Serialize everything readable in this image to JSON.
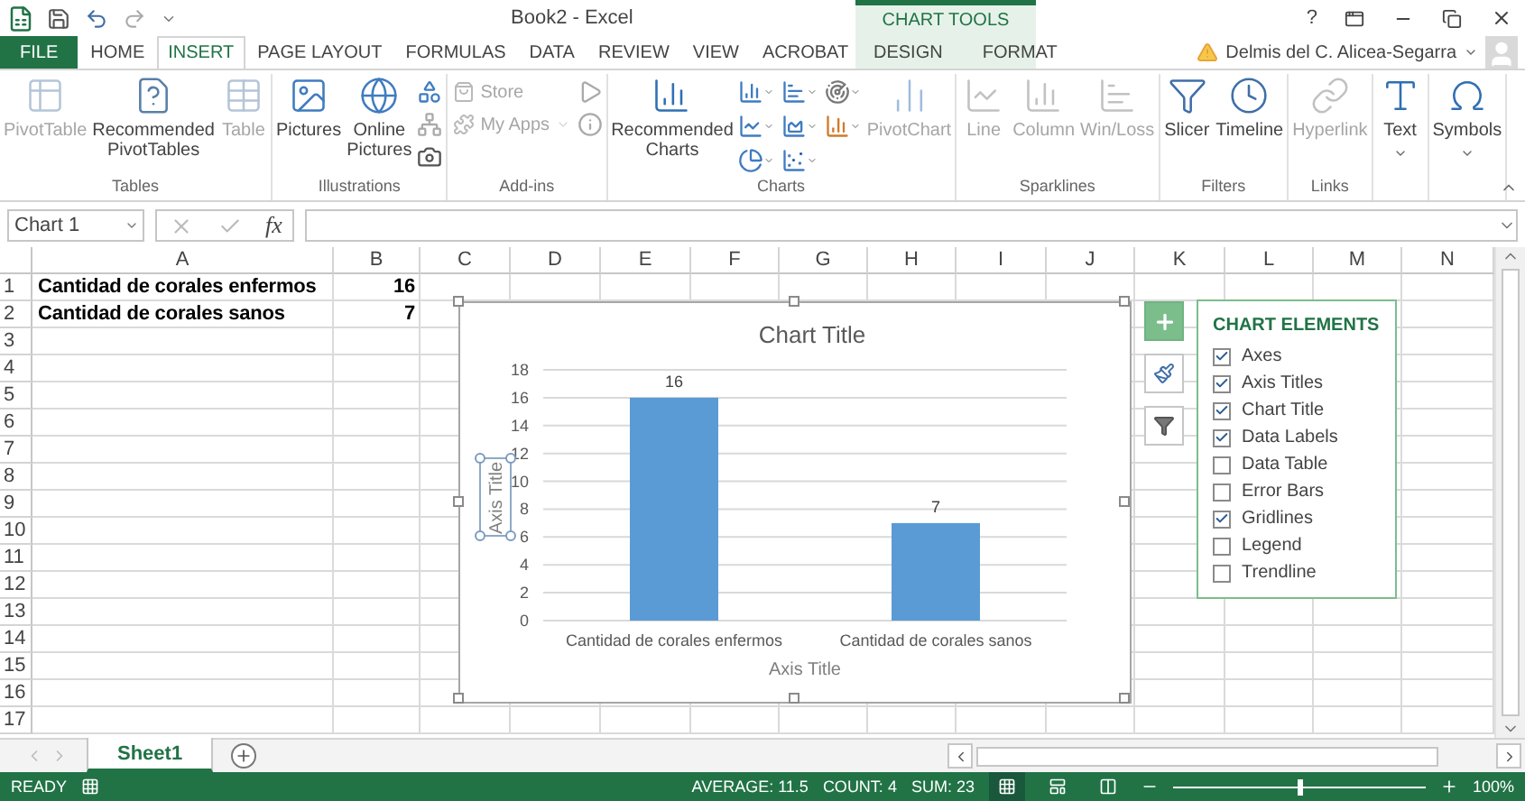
{
  "title_bar": {
    "title": "Book2 - Excel",
    "context_label": "CHART TOOLS",
    "help": "?"
  },
  "tabs": [
    {
      "label": "FILE",
      "kind": "file",
      "selected": false
    },
    {
      "label": "HOME",
      "kind": "normal",
      "selected": false
    },
    {
      "label": "INSERT",
      "kind": "normal",
      "selected": true
    },
    {
      "label": "PAGE LAYOUT",
      "kind": "normal",
      "selected": false
    },
    {
      "label": "FORMULAS",
      "kind": "normal",
      "selected": false
    },
    {
      "label": "DATA",
      "kind": "normal",
      "selected": false
    },
    {
      "label": "REVIEW",
      "kind": "normal",
      "selected": false
    },
    {
      "label": "VIEW",
      "kind": "normal",
      "selected": false
    },
    {
      "label": "ACROBAT",
      "kind": "normal",
      "selected": false
    },
    {
      "label": "DESIGN",
      "kind": "context",
      "selected": false
    },
    {
      "label": "FORMAT",
      "kind": "context",
      "selected": false
    }
  ],
  "user": {
    "name": "Delmis del C. Alicea-Segarra"
  },
  "ribbon": {
    "groups": [
      {
        "label": "Tables",
        "items": [
          {
            "label": "PivotTable",
            "kind": "large",
            "disabled": true
          },
          {
            "label": "Recommended PivotTables",
            "kind": "large",
            "disabled": false
          },
          {
            "label": "Table",
            "kind": "large",
            "disabled": true
          }
        ]
      },
      {
        "label": "Illustrations",
        "items": [
          {
            "label": "Pictures",
            "kind": "large",
            "disabled": false
          },
          {
            "label": "Online Pictures",
            "kind": "large",
            "disabled": false
          }
        ]
      },
      {
        "label": "Add-ins",
        "items": [
          {
            "label": "Store",
            "kind": "small",
            "disabled": true
          },
          {
            "label": "My Apps",
            "kind": "small",
            "disabled": true
          }
        ]
      },
      {
        "label": "Charts",
        "items": [
          {
            "label": "Recommended Charts",
            "kind": "large",
            "disabled": false
          },
          {
            "label": "PivotChart",
            "kind": "large",
            "disabled": true
          }
        ]
      },
      {
        "label": "Sparklines",
        "items": [
          {
            "label": "Line",
            "kind": "large",
            "disabled": true
          },
          {
            "label": "Column",
            "kind": "large",
            "disabled": true
          },
          {
            "label": "Win/Loss",
            "kind": "large",
            "disabled": true
          }
        ]
      },
      {
        "label": "Filters",
        "items": [
          {
            "label": "Slicer",
            "kind": "large",
            "disabled": false
          },
          {
            "label": "Timeline",
            "kind": "large",
            "disabled": false
          }
        ]
      },
      {
        "label": "Links",
        "items": [
          {
            "label": "Hyperlink",
            "kind": "large",
            "disabled": true
          }
        ]
      },
      {
        "items": [
          {
            "label": "Text",
            "kind": "large",
            "disabled": false
          }
        ]
      },
      {
        "items": [
          {
            "label": "Symbols",
            "kind": "large",
            "disabled": false
          }
        ]
      }
    ]
  },
  "formula_bar": {
    "name_box": "Chart 1",
    "function_label": "fx"
  },
  "columns": [
    "A",
    "B",
    "C",
    "D",
    "E",
    "F",
    "G",
    "H",
    "I",
    "J",
    "K",
    "L",
    "M",
    "N"
  ],
  "rows": [
    {
      "number": "1",
      "cells": [
        {
          "text": "Cantidad de corales enfermos",
          "kind": "text"
        },
        {
          "text": "16",
          "kind": "number"
        }
      ]
    },
    {
      "number": "2",
      "cells": [
        {
          "text": "Cantidad de corales sanos",
          "kind": "text"
        },
        {
          "text": "7",
          "kind": "number"
        }
      ]
    },
    {
      "number": "3"
    },
    {
      "number": "4"
    },
    {
      "number": "5"
    },
    {
      "number": "6"
    },
    {
      "number": "7"
    },
    {
      "number": "8"
    },
    {
      "number": "9"
    },
    {
      "number": "10"
    },
    {
      "number": "11"
    },
    {
      "number": "12"
    },
    {
      "number": "13"
    },
    {
      "number": "14"
    },
    {
      "number": "15"
    },
    {
      "number": "16"
    },
    {
      "number": "17"
    }
  ],
  "chart": {
    "chart_data": {
      "type": "bar",
      "title": "Chart Title",
      "xlabel": "Axis Title",
      "ylabel": "Axis Title",
      "categories": [
        "Cantidad de corales enfermos",
        "Cantidad de corales sanos"
      ],
      "series": [
        {
          "color": "#5b9bd5",
          "values": [
            16,
            7
          ]
        }
      ],
      "ylim": [
        0,
        18
      ],
      "yticks": [
        0,
        2,
        4,
        6,
        8,
        10,
        12,
        14,
        16,
        18
      ],
      "grid": true,
      "data_labels": true
    }
  },
  "chart_elements": {
    "title": "CHART ELEMENTS",
    "items": [
      {
        "label": "Axes",
        "checked": true
      },
      {
        "label": "Axis Titles",
        "checked": true
      },
      {
        "label": "Chart Title",
        "checked": true
      },
      {
        "label": "Data Labels",
        "checked": true
      },
      {
        "label": "Data Table",
        "checked": false
      },
      {
        "label": "Error Bars",
        "checked": false
      },
      {
        "label": "Gridlines",
        "checked": true
      },
      {
        "label": "Legend",
        "checked": false
      },
      {
        "label": "Trendline",
        "checked": false
      }
    ]
  },
  "sheet_tabs": [
    {
      "label": "Sheet1",
      "selected": true
    }
  ],
  "status_bar": {
    "status": "READY",
    "average": "AVERAGE: 11.5",
    "count": "COUNT: 4",
    "sum": "SUM: 23",
    "views": [
      {
        "selected": true
      },
      {
        "selected": false
      },
      {
        "selected": false
      }
    ],
    "zoom_slider": {
      "level": 0.5
    },
    "zoom": "100%"
  }
}
